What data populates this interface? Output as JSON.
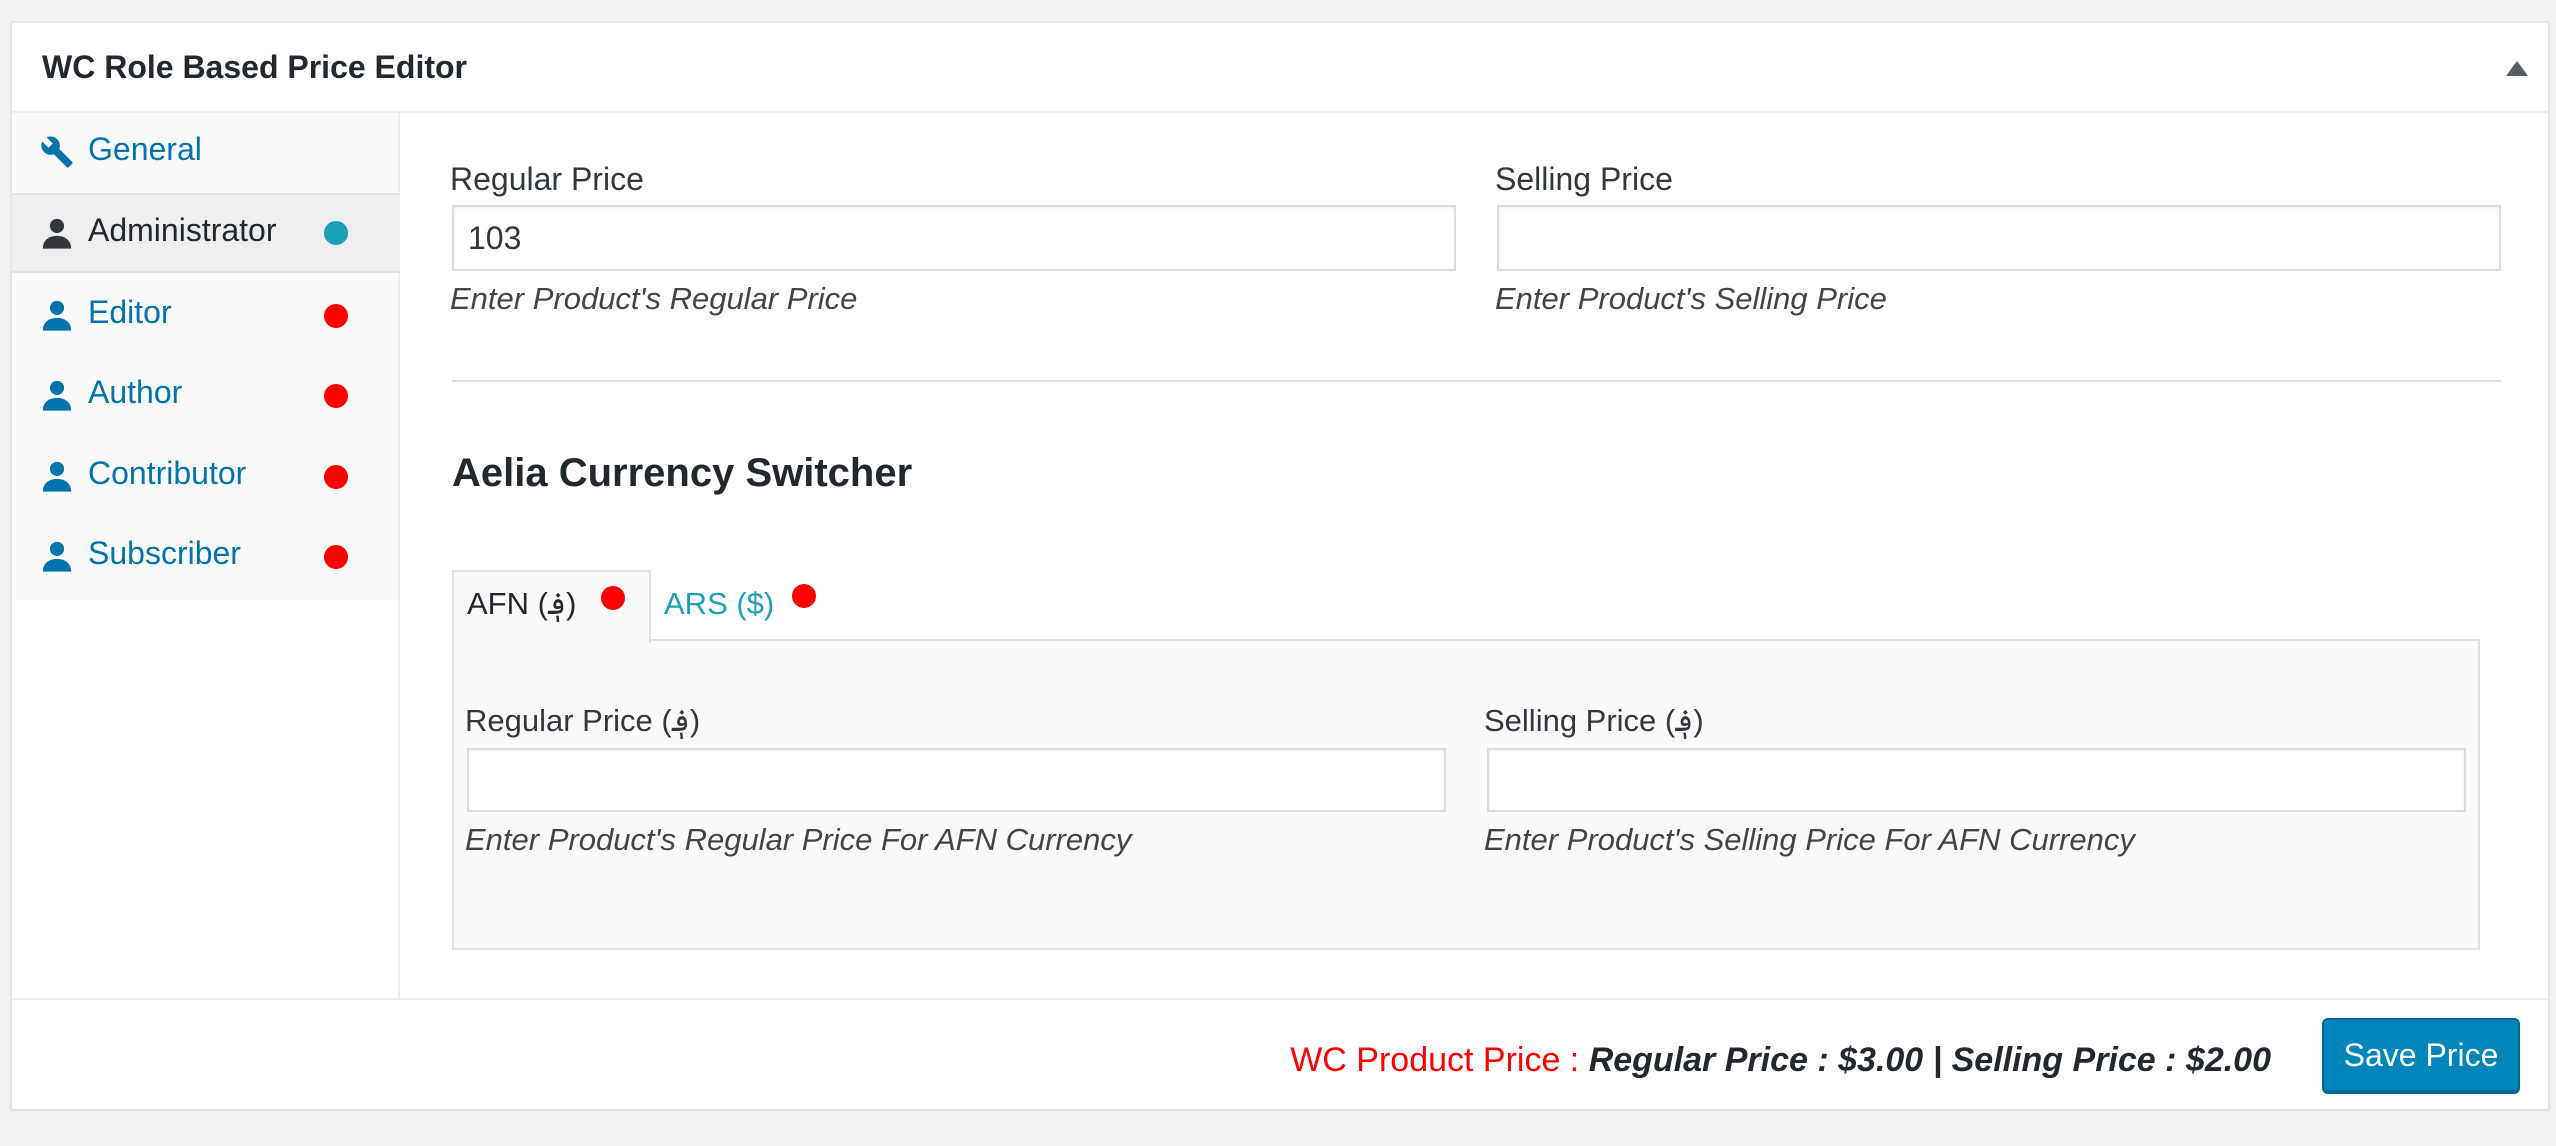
{
  "panel": {
    "title": "WC Role Based Price Editor"
  },
  "sidebar": {
    "items": [
      {
        "label": "General",
        "icon": "wrench-icon",
        "status": "none"
      },
      {
        "label": "Administrator",
        "icon": "user-icon",
        "status": "teal"
      },
      {
        "label": "Editor",
        "icon": "user-icon",
        "status": "red"
      },
      {
        "label": "Author",
        "icon": "user-icon",
        "status": "red"
      },
      {
        "label": "Contributor",
        "icon": "user-icon",
        "status": "red"
      },
      {
        "label": "Subscriber",
        "icon": "user-icon",
        "status": "red"
      }
    ],
    "active_item": "Administrator"
  },
  "main": {
    "regular_price": {
      "label": "Regular Price",
      "value": "103",
      "description": "Enter Product's Regular Price"
    },
    "selling_price": {
      "label": "Selling Price",
      "value": "",
      "description": "Enter Product's Selling Price"
    },
    "currency_section": {
      "title": "Aelia Currency Switcher",
      "tabs": [
        {
          "label": "AFN (؋)",
          "active": true
        },
        {
          "label": "ARS ($)",
          "active": false
        }
      ],
      "regular_price": {
        "label": "Regular Price (؋)",
        "value": "",
        "description": "Enter Product's Regular Price For AFN Currency"
      },
      "selling_price": {
        "label": "Selling Price (؋)",
        "value": "",
        "description": "Enter Product's Selling Price For AFN Currency"
      }
    }
  },
  "footer": {
    "price_prefix": "WC Product Price : ",
    "price_values": "Regular Price : $3.00 | Selling Price : $2.00",
    "save_label": "Save Price"
  },
  "colors": {
    "link": "#0073aa",
    "status_red": "#ff0000",
    "status_teal": "#1da0b6",
    "button": "#0085ba"
  }
}
